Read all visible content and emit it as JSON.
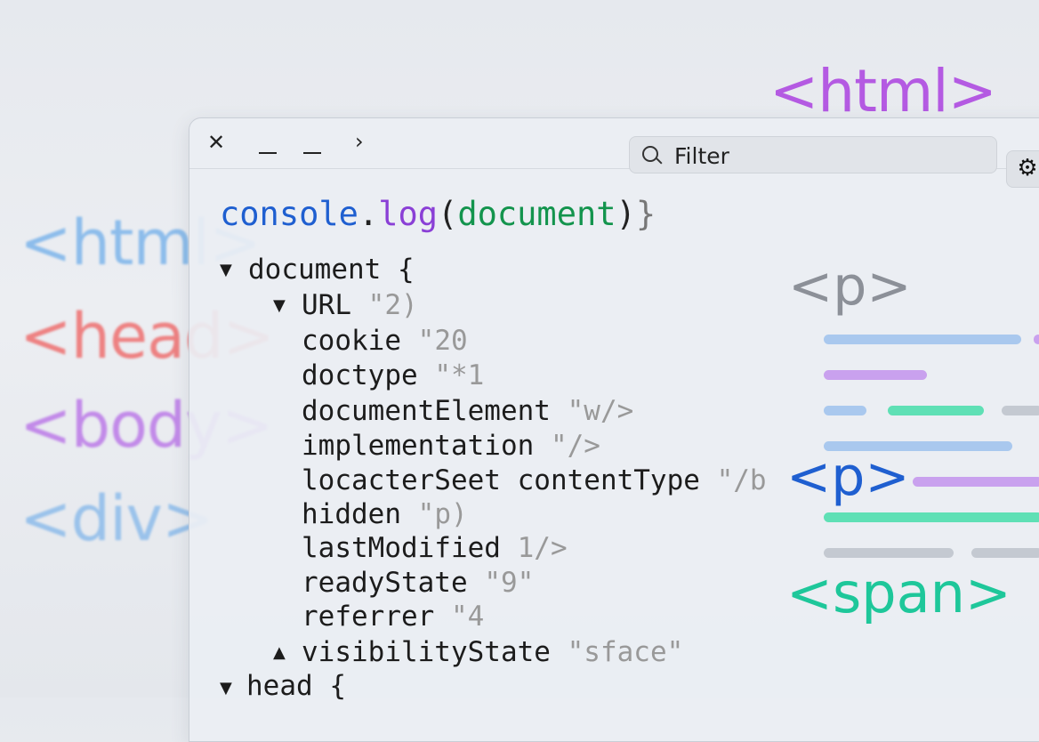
{
  "background_tags": {
    "left": [
      "<html>",
      "<head>",
      "<body>",
      "<div>"
    ],
    "top_right": "<html>"
  },
  "toolbar": {
    "close_glyph": "✕",
    "more_glyph": "›",
    "filter_placeholder": "Filter",
    "gear_glyph": "⚙"
  },
  "console": {
    "command": {
      "obj": "console",
      "dot": ".",
      "method": "log",
      "open": "(",
      "arg": "document",
      "close": ")",
      "tail": "}"
    },
    "document_label": "document {",
    "url_key": "URL",
    "url_val": "\"2)",
    "properties": [
      {
        "key": "cookie",
        "val": "\"20"
      },
      {
        "key": "doctype",
        "val": "\"*1"
      },
      {
        "key": "documentElement",
        "val": "\"w/>"
      },
      {
        "key": "implementation",
        "val": "\"/>"
      },
      {
        "key": "locacterSeet contentType",
        "val": "\"/b"
      },
      {
        "key": "hidden",
        "val": "\"p)"
      },
      {
        "key": "lastModified",
        "val": "1/>"
      },
      {
        "key": "readyState",
        "val": "\"9\""
      },
      {
        "key": "referrer",
        "val": "\"4"
      }
    ],
    "visibility_key": "visibilityState",
    "visibility_val": "\"sface\"",
    "head_label": "head {"
  },
  "right_panel": {
    "tag_p1": "<p>",
    "tag_p2": "<p>",
    "tag_span": "<span>"
  },
  "colors": {
    "blue": "#1f5fd0",
    "green": "#13944d",
    "purple": "#8a3fd6",
    "teal": "#1ec79a",
    "line_blue": "#a9c8ee",
    "line_purple": "#c9a1ee",
    "line_teal": "#5fe0b5",
    "line_gray": "#c4c9d1"
  }
}
